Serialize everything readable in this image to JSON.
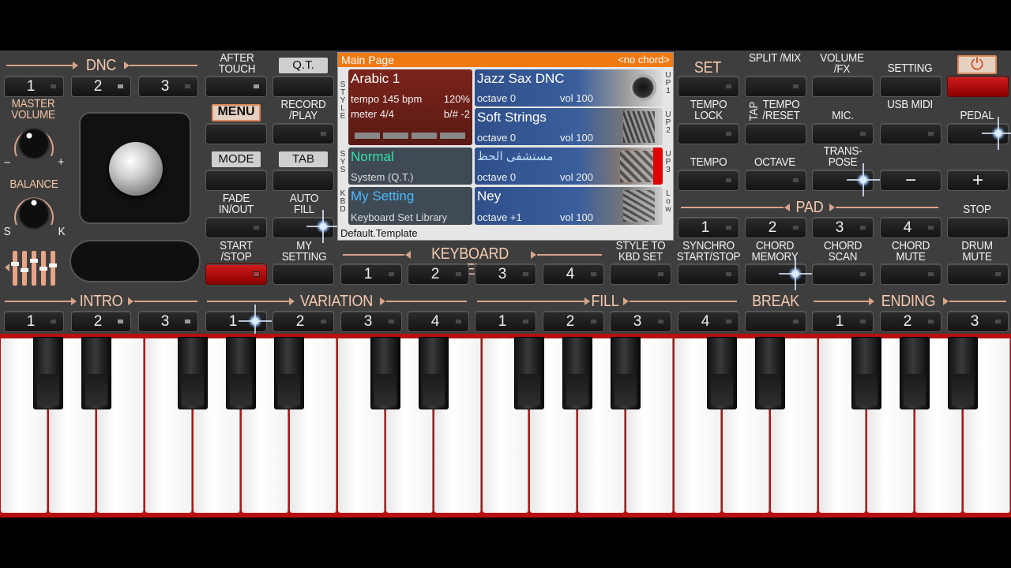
{
  "screen": {
    "title": "Main Page",
    "chord": "<no chord>",
    "left_tags": {
      "style": "S T Y L E",
      "sys": "S Y S",
      "kbd": "K B D"
    },
    "right_tags": {
      "up1": "U P 1",
      "up2": "U P 2",
      "up3": "U P 3",
      "low": "L o w"
    },
    "style_cell": {
      "name": "Arabic 1",
      "tempo": "tempo 145 bpm",
      "percent": "120%",
      "meter": "meter 4/4",
      "transpose": "b/# -2"
    },
    "sys_cell": {
      "name": "Normal",
      "sub": "System (Q.T.)"
    },
    "kbd_cell": {
      "name": "My Setting",
      "sub": "Keyboard Set Library"
    },
    "voices": [
      {
        "name": "Jazz Sax DNC",
        "octave": "octave  0",
        "vol": "vol 100"
      },
      {
        "name": "Soft Strings",
        "octave": "octave  0",
        "vol": "vol 100"
      },
      {
        "name": "مستشفى الحظ",
        "octave": "octave  0",
        "vol": "vol 200"
      },
      {
        "name": "Ney",
        "octave": "octave +1",
        "vol": "vol 100"
      }
    ],
    "footer": "Default.Template"
  },
  "labels": {
    "dnc": "DNC",
    "after_touch": "AFTER TOUCH",
    "qt": "Q.T.",
    "master_volume": "MASTER VOLUME",
    "minus": "–",
    "plus": "+",
    "balance": "BALANCE",
    "s": "S",
    "k": "K",
    "menu": "MENU",
    "record_play": "RECORD /PLAY",
    "mode": "MODE",
    "tab": "TAB",
    "fade_in_out": "FADE IN/OUT",
    "auto_fill": "AUTO FILL",
    "start_stop": "START /STOP",
    "my_setting": "MY SETTING",
    "set": "SET",
    "split_mix": "SPLIT /MIX",
    "volume_fx": "VOLUME /FX",
    "setting": "SETTING",
    "tempo_lock": "TEMPO LOCK",
    "tap": "TAP",
    "tempo_reset": "TEMPO /RESET",
    "mic": "MIC.",
    "usb_midi": "USB MIDI",
    "pedal": "PEDAL",
    "tempo": "TEMPO",
    "octave": "OCTAVE",
    "transpose": "TRANS- POSE",
    "pad": "PAD",
    "stop": "STOP",
    "keyboard_set": "KEYBOARD SET",
    "style_to_kbd_set": "STYLE TO KBD SET",
    "synchro_start_stop": "SYNCHRO START/STOP",
    "chord_memory": "CHORD MEMORY",
    "chord_scan": "CHORD SCAN",
    "chord_mute": "CHORD MUTE",
    "drum_mute": "DRUM MUTE",
    "intro": "INTRO",
    "variation": "VARIATION",
    "fill": "FILL",
    "break": "BREAK",
    "ending": "ENDING"
  },
  "numbers": {
    "n1": "1",
    "n2": "2",
    "n3": "3",
    "n4": "4",
    "minus": "−",
    "plus": "+",
    "power": "⏻"
  },
  "colors": {
    "accent": "#f07a12",
    "button_red": "#c81414",
    "separator": "#d9a48a",
    "panel": "#3e3e3e"
  }
}
